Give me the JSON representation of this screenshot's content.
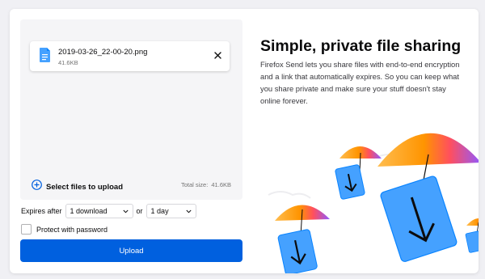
{
  "upload": {
    "file": {
      "name": "2019-03-26_22-00-20.png",
      "size": "41.6KB",
      "icon": "file-icon"
    },
    "remove_icon": "close-icon",
    "select_files_label": "Select files to upload",
    "total_size_label": "Total size:",
    "total_size_value": "41.6KB"
  },
  "options": {
    "expires_label": "Expires after",
    "downloads_value": "1 download",
    "or_label": "or",
    "days_value": "1 day",
    "password_label": "Protect with password"
  },
  "upload_button": "Upload",
  "intro": {
    "title": "Simple, private file sharing",
    "description": "Firefox Send lets you share files with end-to-end encryption and a link that automatically expires. So you can keep what you share private and make sure your stuff doesn't stay online forever."
  },
  "colors": {
    "accent": "#0060df",
    "file_blue": "#45a1ff",
    "umbrella_orange": "#ff9400",
    "umbrella_pink": "#ff4f5e",
    "umbrella_purple": "#9059ff"
  }
}
